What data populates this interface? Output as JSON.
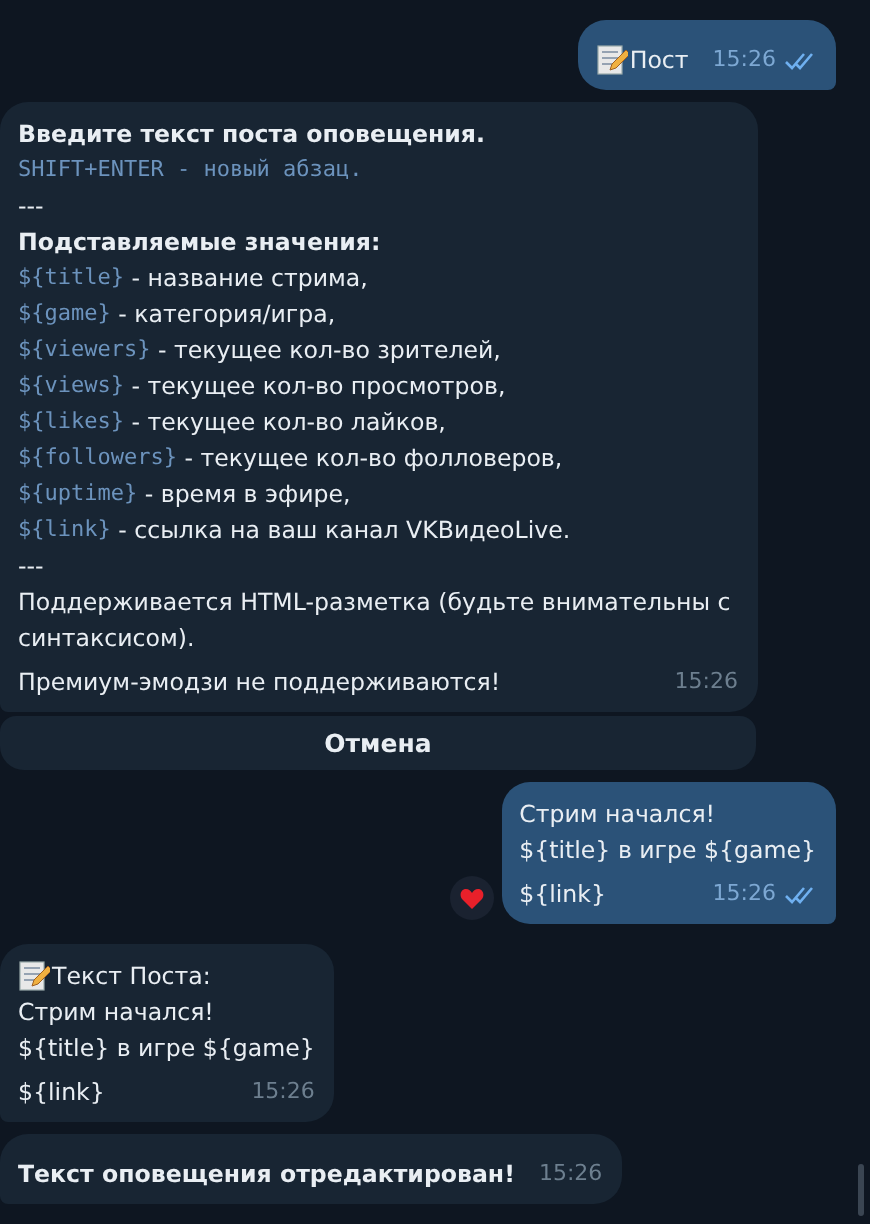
{
  "messages": [
    {
      "kind": "outgoing",
      "memo": true,
      "lines": [
        [
          {
            "kind": "plain",
            "text": "Пост"
          }
        ]
      ],
      "time": "15:26",
      "read": true
    },
    {
      "kind": "incoming",
      "lines": [
        [
          {
            "kind": "bold",
            "text": "Введите текст поста оповещения."
          }
        ],
        [
          {
            "kind": "code",
            "text": "SHIFT+ENTER - новый абзац."
          }
        ],
        [
          {
            "kind": "plain",
            "text": "---"
          }
        ],
        [
          {
            "kind": "bold",
            "text": "Подставляемые значения:"
          }
        ],
        [
          {
            "kind": "code",
            "text": "${title}"
          },
          {
            "kind": "plain",
            "text": " - название стрима,"
          }
        ],
        [
          {
            "kind": "code",
            "text": "${game}"
          },
          {
            "kind": "plain",
            "text": " - категория/игра,"
          }
        ],
        [
          {
            "kind": "code",
            "text": "${viewers}"
          },
          {
            "kind": "plain",
            "text": " - текущее кол-во зрителей,"
          }
        ],
        [
          {
            "kind": "code",
            "text": "${views}"
          },
          {
            "kind": "plain",
            "text": " - текущее кол-во просмотров,"
          }
        ],
        [
          {
            "kind": "code",
            "text": "${likes}"
          },
          {
            "kind": "plain",
            "text": " - текущее кол-во лайков,"
          }
        ],
        [
          {
            "kind": "code",
            "text": "${followers}"
          },
          {
            "kind": "plain",
            "text": " - текущее кол-во фолловеров,"
          }
        ],
        [
          {
            "kind": "code",
            "text": "${uptime}"
          },
          {
            "kind": "plain",
            "text": " - время в эфире,"
          }
        ],
        [
          {
            "kind": "code",
            "text": "${link}"
          },
          {
            "kind": "plain",
            "text": " - ссылка на ваш канал VKВидеоLive."
          }
        ],
        [
          {
            "kind": "plain",
            "text": "---"
          }
        ],
        [
          {
            "kind": "plain",
            "text": "Поддерживается HTML-разметка (будьте внимательны с синтаксисом)."
          }
        ],
        [
          {
            "kind": "plain",
            "text": "Премиум-эмодзи не поддерживаются!"
          }
        ]
      ],
      "time": "15:26",
      "buttons": [
        "Отмена"
      ]
    },
    {
      "kind": "outgoing",
      "reaction": true,
      "lines": [
        [
          {
            "kind": "plain",
            "text": "Стрим начался!"
          }
        ],
        [
          {
            "kind": "plain",
            "text": "${title} в игре ${game}"
          }
        ],
        [
          {
            "kind": "plain",
            "text": "${link}"
          }
        ]
      ],
      "time": "15:26",
      "read": true
    },
    {
      "kind": "incoming",
      "memo": true,
      "lines": [
        [
          {
            "kind": "plain",
            "text": "Текст Поста:"
          }
        ],
        [
          {
            "kind": "plain",
            "text": "Стрим начался!"
          }
        ],
        [
          {
            "kind": "plain",
            "text": "${title} в игре ${game}"
          }
        ],
        [
          {
            "kind": "plain",
            "text": "${link}"
          }
        ]
      ],
      "time": "15:26"
    },
    {
      "kind": "incoming",
      "lines": [
        [
          {
            "kind": "bold",
            "text": "Текст оповещения отредактирован!"
          }
        ]
      ],
      "time": "15:26"
    }
  ]
}
